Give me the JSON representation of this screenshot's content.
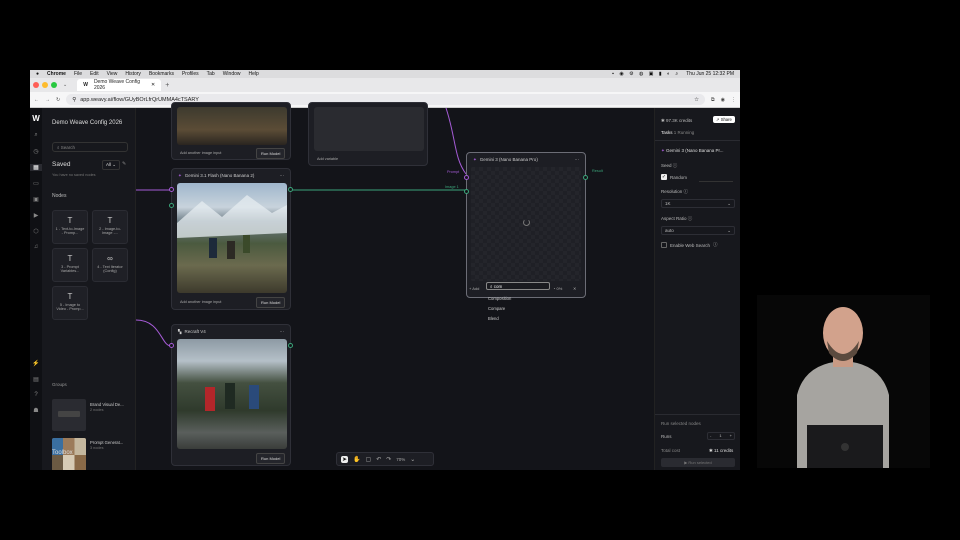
{
  "mac_menu": {
    "apple": "",
    "app": "Chrome",
    "items": [
      "File",
      "Edit",
      "View",
      "History",
      "Bookmarks",
      "Profiles",
      "Tab",
      "Window",
      "Help"
    ],
    "clock": "Thu Jun 25  12:32 PM"
  },
  "browser": {
    "tab_title": "Demo Weave Config 2026",
    "url": "app.weavy.ai/flow/GUyBOrLfrQrUMMA4cTSARY"
  },
  "app": {
    "project_title": "Demo Weave Config 2026"
  },
  "left_panel": {
    "search_placeholder": "Search",
    "saved_label": "Saved",
    "saved_filter": "All",
    "saved_empty": "You have no saved nodes",
    "nodes_label": "Nodes",
    "node_cards": [
      {
        "icon": "T",
        "label": "1 - Text-to-Image - Promp..."
      },
      {
        "icon": "T",
        "label": "2 - Image-to-Image -..."
      },
      {
        "icon": "T",
        "label": "3 - Prompt Variables..."
      },
      {
        "icon": "∞",
        "label": "4 - Text Iterator (Config)"
      },
      {
        "icon": "T",
        "label": "5 - Image to Video - Promp..."
      }
    ],
    "groups_label": "Groups",
    "groups": [
      {
        "name": "Brand Visual De...",
        "meta": "2 nodes"
      },
      {
        "name": "Prompt Generat...",
        "meta": "3 nodes"
      }
    ],
    "toolbox_label": "Toolbox"
  },
  "canvas": {
    "node_top": {
      "add_link": "Add another image input",
      "run": "Run Model"
    },
    "node_vars": {
      "add_link": "Add variable"
    },
    "node_flash": {
      "title": "Gemini 3.1 Flash (Nano Banana 2)",
      "add_link": "Add another image input",
      "run": "Run Model"
    },
    "node_recraft": {
      "title": "Recraft V4",
      "run": "Run Model"
    },
    "node_gemini3": {
      "title": "Gemini 3 (Nano Banana Pro)",
      "port_prompt": "Prompt",
      "port_image": "Image 1",
      "port_result": "Result",
      "search_value": "com",
      "menu": [
        "Composition",
        "Compare",
        "Blend"
      ],
      "add": "Add",
      "progress": "0%"
    },
    "toolbar": {
      "zoom": "70%"
    }
  },
  "right_panel": {
    "credits": "97.3K credits",
    "share": "Share",
    "tasks": "Tasks",
    "tasks_status": "1 Running",
    "model_name": "Gemini 3 (Nano Banana Pr...",
    "seed_label": "Seed",
    "random_label": "Random",
    "seed_value": "",
    "resolution_label": "Resolution",
    "resolution_value": "1K",
    "aspect_label": "Aspect Ratio",
    "aspect_value": "auto",
    "web_search_label": "Enable Web Search",
    "run_selected": "Run selected nodes",
    "runs_label": "Runs",
    "runs_value": "1",
    "total_cost_label": "Total cost",
    "total_cost_value": "11 credits",
    "run_button": "Run selected"
  },
  "colors": {
    "accent_purple": "#a55bd6",
    "port_green": "#3ba57a"
  }
}
